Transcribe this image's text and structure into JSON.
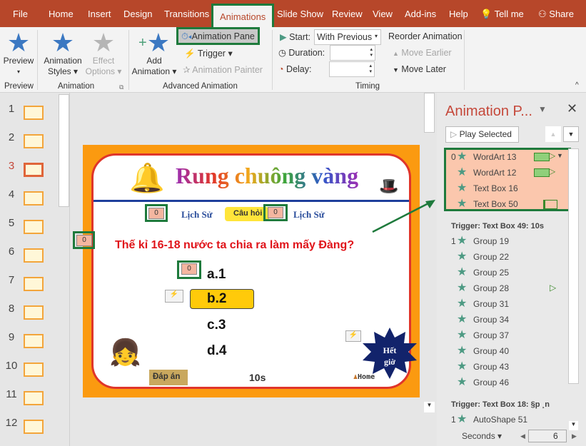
{
  "tabs": [
    "File",
    "Home",
    "Insert",
    "Design",
    "Transitions",
    "Animations",
    "Slide Show",
    "Review",
    "View",
    "Add-ins",
    "Help",
    "Tell me",
    "Share"
  ],
  "ribbon": {
    "preview": "Preview",
    "preview_group": "Preview",
    "animation_styles": [
      "Animation",
      "Styles"
    ],
    "effect_options": [
      "Effect",
      "Options"
    ],
    "animation_group": "Animation",
    "add_animation": [
      "Add",
      "Animation"
    ],
    "animation_pane": "Animation Pane",
    "trigger": "Trigger",
    "animation_painter": "Animation Painter",
    "advanced_group": "Advanced Animation",
    "start_label": "Start:",
    "start_value": "With Previous",
    "duration_label": "Duration:",
    "duration_value": "",
    "delay_label": "Delay:",
    "delay_value": "",
    "timing_group": "Timing",
    "reorder": "Reorder Animation",
    "move_earlier": "Move Earlier",
    "move_later": "Move Later"
  },
  "thumbnails": {
    "numbers": [
      "1",
      "2",
      "3",
      "4",
      "5",
      "6",
      "7",
      "8",
      "9",
      "10",
      "11",
      "12"
    ],
    "selected": "3"
  },
  "slide": {
    "title": "Rung chuông vàng",
    "subject_left": "Lịch Sử",
    "question_tag": "Câu hỏi",
    "subject_right": "Lịch Sử",
    "counter_a": "0",
    "counter_b": "0",
    "counter_left": "0",
    "counter_answer": "0",
    "question": "Thế kỉ 16-18 nước ta chia ra làm mấy Đàng?",
    "answers": [
      "a.1",
      "b.2",
      "c.3",
      "d.4"
    ],
    "answer_button": "Đáp án",
    "timer": "10s",
    "home": "Home",
    "time_up": [
      "Hết",
      "giờ"
    ]
  },
  "pane": {
    "title": "Animation P...",
    "play_selected": "Play Selected",
    "group0": [
      {
        "num": "0",
        "label": "WordArt 13"
      },
      {
        "num": "",
        "label": "WordArt 12"
      },
      {
        "num": "",
        "label": "Text Box 16"
      },
      {
        "num": "",
        "label": "Text Box 50"
      }
    ],
    "trigger1": "Trigger: Text Box 49: 10s",
    "group1": [
      {
        "num": "1",
        "label": "Group 19"
      },
      {
        "num": "",
        "label": "Group 22"
      },
      {
        "num": "",
        "label": "Group 25"
      },
      {
        "num": "",
        "label": "Group 28"
      },
      {
        "num": "",
        "label": "Group 31"
      },
      {
        "num": "",
        "label": "Group 34"
      },
      {
        "num": "",
        "label": "Group 37"
      },
      {
        "num": "",
        "label": "Group 40"
      },
      {
        "num": "",
        "label": "Group 43"
      },
      {
        "num": "",
        "label": "Group 46"
      }
    ],
    "trigger2": "Trigger: Text Box 18: §p ¸n",
    "group2": [
      {
        "num": "1",
        "label": "AutoShape 51"
      }
    ],
    "seconds": "Seconds",
    "timeline_value": "6"
  },
  "colors": {
    "accent": "#b7472a",
    "annotation": "#1e7a3c",
    "highlight": "#fbc7ad"
  }
}
